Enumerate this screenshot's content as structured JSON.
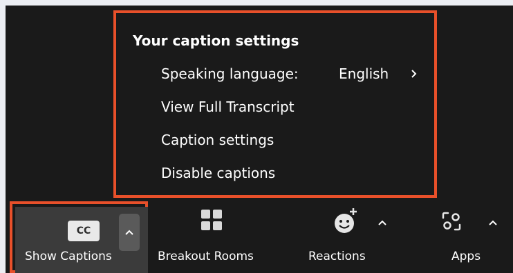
{
  "caption_popup": {
    "title": "Your caption settings",
    "speaking_language_label": "Speaking language:",
    "speaking_language_value": "English",
    "view_transcript": "View Full Transcript",
    "caption_settings": "Caption settings",
    "disable_captions": "Disable captions"
  },
  "toolbar": {
    "show_captions": {
      "label": "Show Captions",
      "badge": "CC"
    },
    "breakout_rooms": {
      "label": "Breakout Rooms"
    },
    "reactions": {
      "label": "Reactions"
    },
    "apps": {
      "label": "Apps"
    }
  },
  "colors": {
    "highlight": "#e8502a",
    "background": "#1a1a1a",
    "active_button": "#3b3b3b"
  },
  "icons": [
    "cc-icon",
    "breakout-rooms-icon",
    "reactions-icon",
    "apps-icon",
    "chevron-up-icon",
    "chevron-right-icon"
  ]
}
